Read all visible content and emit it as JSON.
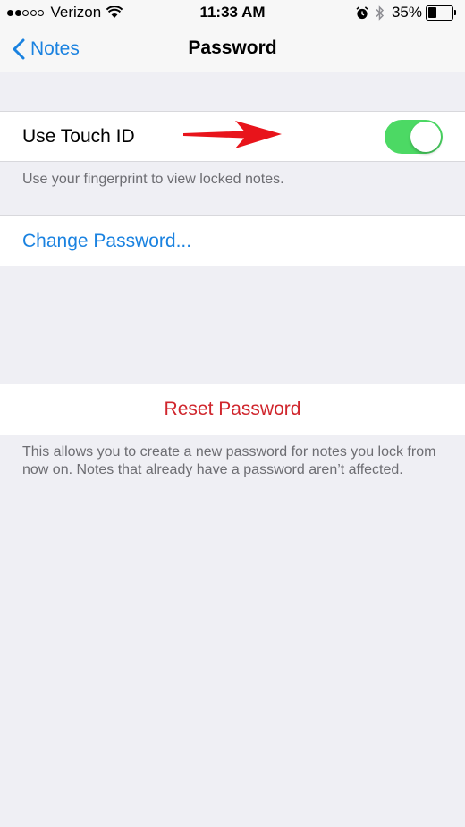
{
  "status_bar": {
    "carrier": "Verizon",
    "time": "11:33 AM",
    "battery_percent": "35%",
    "battery_level": 0.35,
    "signal_bars_filled": 2,
    "signal_bars_total": 5,
    "icons": [
      "wifi-icon",
      "alarm-icon",
      "bluetooth-icon",
      "battery-icon"
    ]
  },
  "nav": {
    "back_label": "Notes",
    "title": "Password"
  },
  "touch_id": {
    "label": "Use Touch ID",
    "enabled": true,
    "footer": "Use your fingerprint to view locked notes."
  },
  "change_password": {
    "label": "Change Password..."
  },
  "reset_password": {
    "label": "Reset Password",
    "footer": "This allows you to create a new password for notes you lock from now on. Notes that already have a password aren’t affected."
  },
  "colors": {
    "accent": "#1a82e0",
    "destructive": "#d0262d",
    "toggle_on": "#4cd964",
    "background": "#efeff4",
    "annotation_arrow": "#e8141b"
  }
}
